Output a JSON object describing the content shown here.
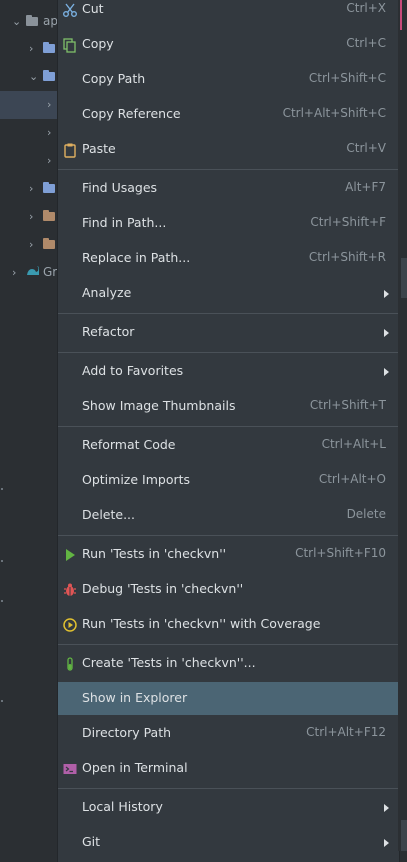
{
  "tree": {
    "root_label": "ap",
    "gradle_label": "Gr"
  },
  "menu": {
    "items": [
      {
        "label": "Cut",
        "shortcut": "Ctrl+X",
        "icon": "scissors-icon"
      },
      {
        "label": "Copy",
        "shortcut": "Ctrl+C",
        "icon": "copy-icon"
      },
      {
        "label": "Copy Path",
        "shortcut": "Ctrl+Shift+C"
      },
      {
        "label": "Copy Reference",
        "shortcut": "Ctrl+Alt+Shift+C"
      },
      {
        "label": "Paste",
        "shortcut": "Ctrl+V",
        "icon": "clipboard-icon"
      },
      {
        "label": "Find Usages",
        "shortcut": "Alt+F7"
      },
      {
        "label": "Find in Path...",
        "shortcut": "Ctrl+Shift+F"
      },
      {
        "label": "Replace in Path...",
        "shortcut": "Ctrl+Shift+R"
      },
      {
        "label": "Analyze",
        "submenu": true
      },
      {
        "label": "Refactor",
        "submenu": true
      },
      {
        "label": "Add to Favorites",
        "submenu": true
      },
      {
        "label": "Show Image Thumbnails",
        "shortcut": "Ctrl+Shift+T"
      },
      {
        "label": "Reformat Code",
        "shortcut": "Ctrl+Alt+L"
      },
      {
        "label": "Optimize Imports",
        "shortcut": "Ctrl+Alt+O"
      },
      {
        "label": "Delete...",
        "shortcut": "Delete"
      },
      {
        "label": "Run 'Tests in 'checkvn''",
        "shortcut": "Ctrl+Shift+F10",
        "icon": "run-icon"
      },
      {
        "label": "Debug 'Tests in 'checkvn''",
        "icon": "debug-icon"
      },
      {
        "label": "Run 'Tests in 'checkvn'' with Coverage",
        "icon": "coverage-icon"
      },
      {
        "label": "Create 'Tests in 'checkvn''...",
        "icon": "test-tube-icon"
      },
      {
        "label": "Show in Explorer",
        "highlighted": true
      },
      {
        "label": "Directory Path",
        "shortcut": "Ctrl+Alt+F12"
      },
      {
        "label": "Open in Terminal",
        "icon": "terminal-icon"
      },
      {
        "label": "Local History",
        "submenu": true
      },
      {
        "label": "Git",
        "submenu": true
      }
    ]
  },
  "colors": {
    "menu_bg": "#33393f",
    "highlight": "#4b6574",
    "separator": "#4a5158",
    "accent_pink": "#c74a7a",
    "folder_blue": "#7f9fd6",
    "folder_brown": "#b08a6a"
  }
}
